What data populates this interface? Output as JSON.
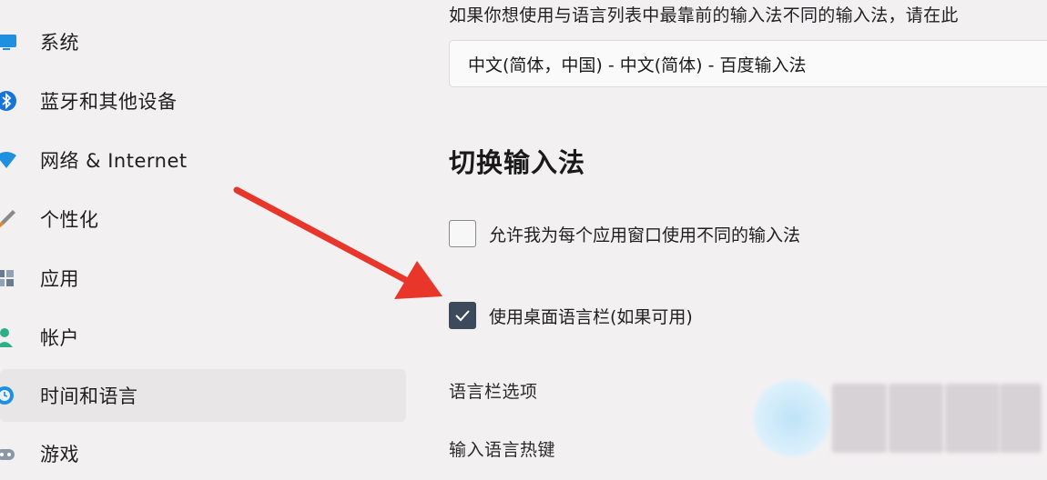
{
  "sidebar": {
    "items": [
      {
        "label": "系统",
        "icon": "monitor-icon"
      },
      {
        "label": "蓝牙和其他设备",
        "icon": "bluetooth-icon"
      },
      {
        "label": "网络 & Internet",
        "icon": "wifi-icon"
      },
      {
        "label": "个性化",
        "icon": "brush-icon"
      },
      {
        "label": "应用",
        "icon": "apps-icon"
      },
      {
        "label": "帐户",
        "icon": "person-icon"
      },
      {
        "label": "时间和语言",
        "icon": "clock-globe-icon",
        "selected": true
      },
      {
        "label": "游戏",
        "icon": "gamepad-icon"
      }
    ]
  },
  "main": {
    "top_hint": "如果你想使用与语言列表中最靠前的输入法不同的输入法，请在此",
    "input_method_select": {
      "value": "中文(简体，中国) - 中文(简体) - 百度输入法"
    },
    "switch_section": {
      "title": "切换输入法",
      "options": [
        {
          "label": "允许我为每个应用窗口使用不同的输入法",
          "checked": false
        },
        {
          "label": "使用桌面语言栏(如果可用)",
          "checked": true
        }
      ]
    },
    "links": {
      "language_bar_options": "语言栏选项",
      "input_language_hotkeys": "输入语言热键"
    }
  },
  "colors": {
    "background": "#f3f0f2",
    "checkbox_checked": "#3c4a5c",
    "annotation_arrow": "#e8362b",
    "selected_nav": "#e9e6e8"
  }
}
